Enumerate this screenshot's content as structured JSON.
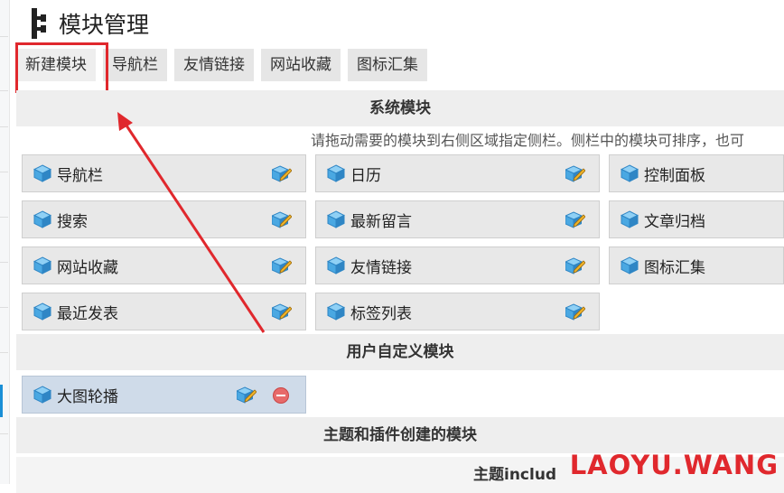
{
  "page": {
    "title": "模块管理"
  },
  "tabs": [
    {
      "label": "新建模块"
    },
    {
      "label": "导航栏"
    },
    {
      "label": "友情链接"
    },
    {
      "label": "网站收藏"
    },
    {
      "label": "图标汇集"
    }
  ],
  "system_modules": {
    "title": "系统模块",
    "hint": "请拖动需要的模块到右侧区域指定侧栏。侧栏中的模块可排序，也可",
    "items": [
      {
        "label": "导航栏"
      },
      {
        "label": "日历"
      },
      {
        "label": "控制面板"
      },
      {
        "label": "搜索"
      },
      {
        "label": "最新留言"
      },
      {
        "label": "文章归档"
      },
      {
        "label": "网站收藏"
      },
      {
        "label": "友情链接"
      },
      {
        "label": "图标汇集"
      },
      {
        "label": "最近发表"
      },
      {
        "label": "标签列表"
      }
    ]
  },
  "custom_modules": {
    "title": "用户自定义模块",
    "items": [
      {
        "label": "大图轮播"
      }
    ]
  },
  "theme_modules": {
    "title": "主题和插件创建的模块",
    "subtitle": "主题includ"
  },
  "watermark": "LAOYU.WANG",
  "colors": {
    "highlight": "#e0282d",
    "accent": "#1a8fd6",
    "module_bg": "#e8e8e8",
    "custom_module_bg": "#cfdbe9"
  },
  "icons": {
    "module": "cube-icon",
    "edit": "edit-icon",
    "remove": "remove-icon",
    "title": "tree-icon"
  }
}
